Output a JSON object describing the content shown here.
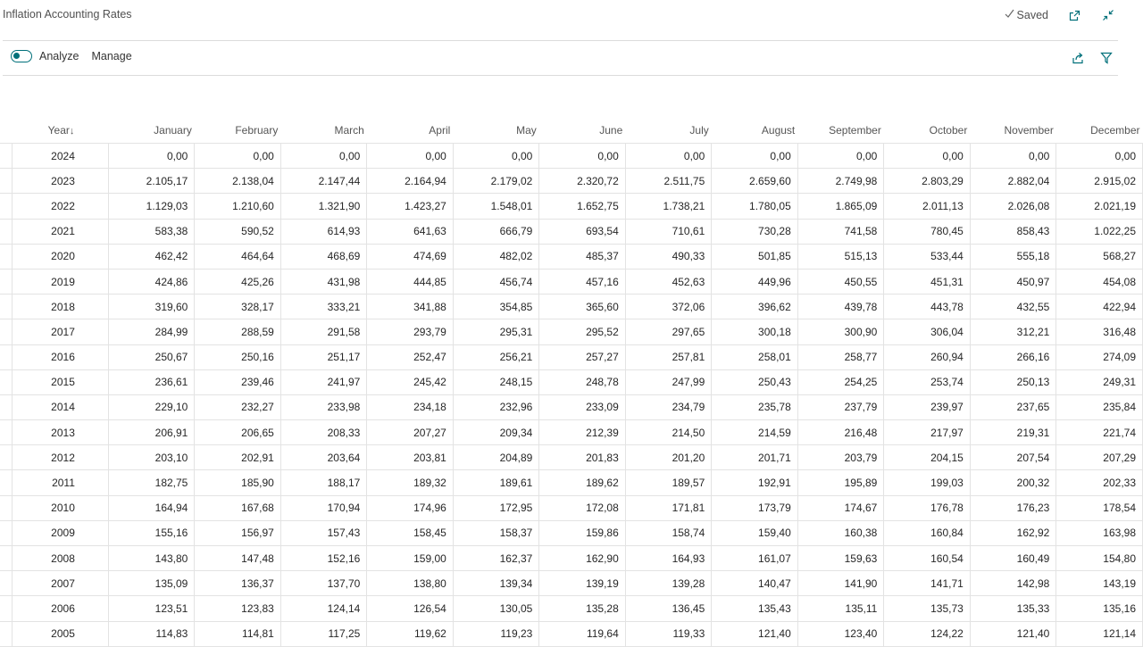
{
  "header": {
    "title": "Inflation Accounting Rates",
    "saved_label": "Saved"
  },
  "actions": {
    "analyze_label": "Analyze",
    "manage_label": "Manage"
  },
  "table": {
    "year_header": "Year",
    "sort_indicator": "↓",
    "months": [
      "January",
      "February",
      "March",
      "April",
      "May",
      "June",
      "July",
      "August",
      "September",
      "October",
      "November",
      "December"
    ],
    "rows": [
      {
        "year": "2024",
        "values": [
          "0,00",
          "0,00",
          "0,00",
          "0,00",
          "0,00",
          "0,00",
          "0,00",
          "0,00",
          "0,00",
          "0,00",
          "0,00",
          "0,00"
        ]
      },
      {
        "year": "2023",
        "values": [
          "2.105,17",
          "2.138,04",
          "2.147,44",
          "2.164,94",
          "2.179,02",
          "2.320,72",
          "2.511,75",
          "2.659,60",
          "2.749,98",
          "2.803,29",
          "2.882,04",
          "2.915,02"
        ]
      },
      {
        "year": "2022",
        "values": [
          "1.129,03",
          "1.210,60",
          "1.321,90",
          "1.423,27",
          "1.548,01",
          "1.652,75",
          "1.738,21",
          "1.780,05",
          "1.865,09",
          "2.011,13",
          "2.026,08",
          "2.021,19"
        ]
      },
      {
        "year": "2021",
        "values": [
          "583,38",
          "590,52",
          "614,93",
          "641,63",
          "666,79",
          "693,54",
          "710,61",
          "730,28",
          "741,58",
          "780,45",
          "858,43",
          "1.022,25"
        ]
      },
      {
        "year": "2020",
        "values": [
          "462,42",
          "464,64",
          "468,69",
          "474,69",
          "482,02",
          "485,37",
          "490,33",
          "501,85",
          "515,13",
          "533,44",
          "555,18",
          "568,27"
        ]
      },
      {
        "year": "2019",
        "values": [
          "424,86",
          "425,26",
          "431,98",
          "444,85",
          "456,74",
          "457,16",
          "452,63",
          "449,96",
          "450,55",
          "451,31",
          "450,97",
          "454,08"
        ]
      },
      {
        "year": "2018",
        "values": [
          "319,60",
          "328,17",
          "333,21",
          "341,88",
          "354,85",
          "365,60",
          "372,06",
          "396,62",
          "439,78",
          "443,78",
          "432,55",
          "422,94"
        ]
      },
      {
        "year": "2017",
        "values": [
          "284,99",
          "288,59",
          "291,58",
          "293,79",
          "295,31",
          "295,52",
          "297,65",
          "300,18",
          "300,90",
          "306,04",
          "312,21",
          "316,48"
        ]
      },
      {
        "year": "2016",
        "values": [
          "250,67",
          "250,16",
          "251,17",
          "252,47",
          "256,21",
          "257,27",
          "257,81",
          "258,01",
          "258,77",
          "260,94",
          "266,16",
          "274,09"
        ]
      },
      {
        "year": "2015",
        "values": [
          "236,61",
          "239,46",
          "241,97",
          "245,42",
          "248,15",
          "248,78",
          "247,99",
          "250,43",
          "254,25",
          "253,74",
          "250,13",
          "249,31"
        ]
      },
      {
        "year": "2014",
        "values": [
          "229,10",
          "232,27",
          "233,98",
          "234,18",
          "232,96",
          "233,09",
          "234,79",
          "235,78",
          "237,79",
          "239,97",
          "237,65",
          "235,84"
        ]
      },
      {
        "year": "2013",
        "values": [
          "206,91",
          "206,65",
          "208,33",
          "207,27",
          "209,34",
          "212,39",
          "214,50",
          "214,59",
          "216,48",
          "217,97",
          "219,31",
          "221,74"
        ]
      },
      {
        "year": "2012",
        "values": [
          "203,10",
          "202,91",
          "203,64",
          "203,81",
          "204,89",
          "201,83",
          "201,20",
          "201,71",
          "203,79",
          "204,15",
          "207,54",
          "207,29"
        ]
      },
      {
        "year": "2011",
        "values": [
          "182,75",
          "185,90",
          "188,17",
          "189,32",
          "189,61",
          "189,62",
          "189,57",
          "192,91",
          "195,89",
          "199,03",
          "200,32",
          "202,33"
        ]
      },
      {
        "year": "2010",
        "values": [
          "164,94",
          "167,68",
          "170,94",
          "174,96",
          "172,95",
          "172,08",
          "171,81",
          "173,79",
          "174,67",
          "176,78",
          "176,23",
          "178,54"
        ]
      },
      {
        "year": "2009",
        "values": [
          "155,16",
          "156,97",
          "157,43",
          "158,45",
          "158,37",
          "159,86",
          "158,74",
          "159,40",
          "160,38",
          "160,84",
          "162,92",
          "163,98"
        ]
      },
      {
        "year": "2008",
        "values": [
          "143,80",
          "147,48",
          "152,16",
          "159,00",
          "162,37",
          "162,90",
          "164,93",
          "161,07",
          "159,63",
          "160,54",
          "160,49",
          "154,80"
        ]
      },
      {
        "year": "2007",
        "values": [
          "135,09",
          "136,37",
          "137,70",
          "138,80",
          "139,34",
          "139,19",
          "139,28",
          "140,47",
          "141,90",
          "141,71",
          "142,98",
          "143,19"
        ]
      },
      {
        "year": "2006",
        "values": [
          "123,51",
          "123,83",
          "124,14",
          "126,54",
          "130,05",
          "135,28",
          "136,45",
          "135,43",
          "135,11",
          "135,73",
          "135,33",
          "135,16"
        ]
      },
      {
        "year": "2005",
        "values": [
          "114,83",
          "114,81",
          "117,25",
          "119,62",
          "119,23",
          "119,64",
          "119,33",
          "121,40",
          "123,40",
          "124,22",
          "121,40",
          "121,14"
        ]
      }
    ]
  },
  "icons": {
    "saved": "checkmark-icon",
    "open_new_window": "open-new-window-icon",
    "collapse": "collapse-icon",
    "share": "share-icon",
    "filter": "filter-icon"
  },
  "colors": {
    "accent": "#00707a",
    "grid": "#e3e3e3"
  }
}
